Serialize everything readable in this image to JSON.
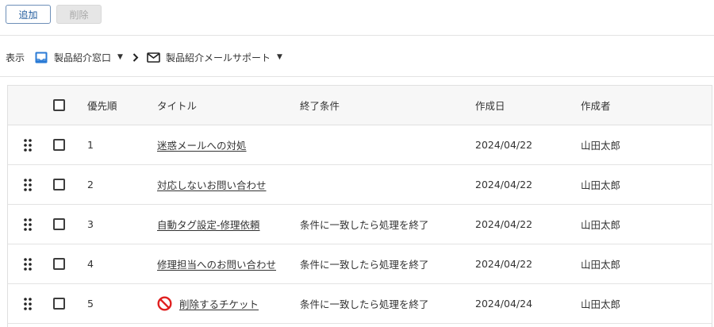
{
  "toolbar": {
    "add_label": "追加",
    "delete_label": "削除"
  },
  "breadcrumb": {
    "label": "表示",
    "items": [
      {
        "label": "製品紹介窓口",
        "icon": "inbox-icon"
      },
      {
        "label": "製品紹介メールサポート",
        "icon": "mail-icon"
      }
    ]
  },
  "table": {
    "columns": {
      "priority": "優先順",
      "title": "タイトル",
      "condition": "終了条件",
      "created": "作成日",
      "author": "作成者"
    },
    "rows": [
      {
        "priority": "1",
        "title": "迷惑メールへの対処",
        "condition": "",
        "created": "2024/04/22",
        "author": "山田太郎",
        "disabled": false
      },
      {
        "priority": "2",
        "title": "対応しないお問い合わせ",
        "condition": "",
        "created": "2024/04/22",
        "author": "山田太郎",
        "disabled": false
      },
      {
        "priority": "3",
        "title": "自動タグ設定-修理依頼",
        "condition": "条件に一致したら処理を終了",
        "created": "2024/04/22",
        "author": "山田太郎",
        "disabled": false
      },
      {
        "priority": "4",
        "title": "修理担当へのお問い合わせ",
        "condition": "条件に一致したら処理を終了",
        "created": "2024/04/22",
        "author": "山田太郎",
        "disabled": false
      },
      {
        "priority": "5",
        "title": "削除するチケット",
        "condition": "条件に一致したら処理を終了",
        "created": "2024/04/24",
        "author": "山田太郎",
        "disabled": true
      }
    ]
  },
  "colors": {
    "accent": "#1f5a9c",
    "inbox_icon": "#2b7bd6",
    "ban_icon": "#e02020"
  }
}
